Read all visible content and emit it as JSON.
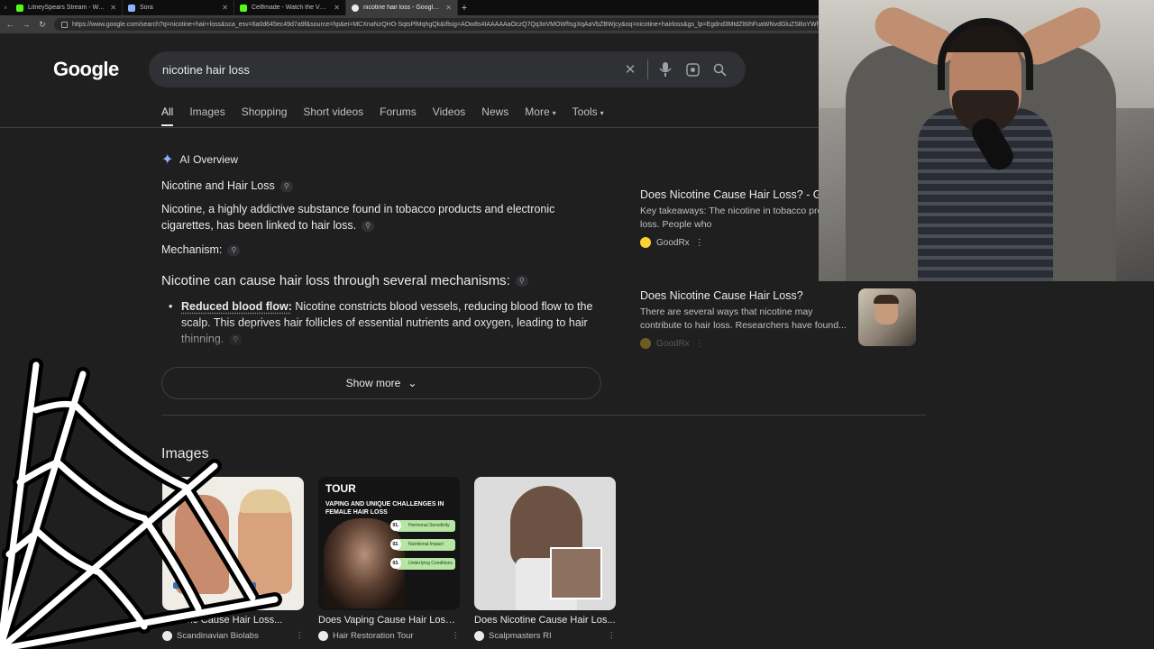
{
  "browser": {
    "tabs": [
      {
        "title": "LitneySpears Stream - Watch Liv",
        "color": "#53fc18",
        "active": false
      },
      {
        "title": "Sora",
        "color": "#8ab4f8",
        "active": false
      },
      {
        "title": "Cellfmade - Watch the VOD on K",
        "color": "#53fc18",
        "active": false
      },
      {
        "title": "nicotine hair loss - Google Search",
        "color": "#e8eaed",
        "active": true
      }
    ],
    "url": "https://www.google.com/search?q=nicotine+hair+loss&sca_esv=6a0d645ec49d7a9f&source=hp&ei=MCXnaNzQHO-SqtsPlMqhgQk&iflsig=AOw8s4IAAAAAaOczQ7Qq3oVMOWfIsgXqAaVbZBWjcy&oq=nicotine+hairloss&gs_lp=Egdnd3MtdZl6IhFuaWNvdGluZSBoYWlyb"
  },
  "google": {
    "logo": "Google",
    "query": "nicotine hair loss",
    "tabs": [
      "All",
      "Images",
      "Shopping",
      "Short videos",
      "Forums",
      "Videos",
      "News",
      "More",
      "Tools"
    ]
  },
  "ai_overview": {
    "label": "AI Overview",
    "title": "Nicotine and Hair Loss",
    "intro": "Nicotine, a highly addictive substance found in tobacco products and electronic cigarettes, has been linked to hair loss.",
    "mechanism_label": "Mechanism:",
    "heading": "Nicotine can cause hair loss through several mechanisms:",
    "bullet_bold": "Reduced blood flow:",
    "bullet_text": " Nicotine constricts blood vessels, reducing blood flow to the scalp. This deprives hair follicles of essential nutrients and oxygen, leading to hair thinning.",
    "show_more": "Show more"
  },
  "sources": [
    {
      "title": "Does Nicotine Cause Hair Loss? - GoodRx",
      "snippet": "Key takeaways: The nicotine in tobacco products can cause hair loss. People who",
      "site": "GoodRx"
    },
    {
      "title": "Does Nicotine Cause Hair Loss?",
      "snippet": "There are several ways that nicotine may contribute to hair loss. Researchers have found...",
      "site": "GoodRx"
    }
  ],
  "images": {
    "heading": "Images",
    "items": [
      {
        "caption": "Nicotine Cause Hair Loss...",
        "source": "Scandinavian Biolabs"
      },
      {
        "caption": "Does Vaping Cause Hair Loss ...",
        "source": "Hair Restoration Tour",
        "img_title": "TOUR",
        "img_sub": "VAPING AND UNIQUE CHALLENGES IN FEMALE HAIR LOSS",
        "img_points": [
          "Hormonal Sensitivity",
          "Nutritional Impact",
          "Underlying Conditions"
        ],
        "img_nums": [
          "01.",
          "02.",
          "03."
        ]
      },
      {
        "caption": "Does Nicotine Cause Hair Los...",
        "source": "Scalpmasters RI"
      }
    ]
  }
}
